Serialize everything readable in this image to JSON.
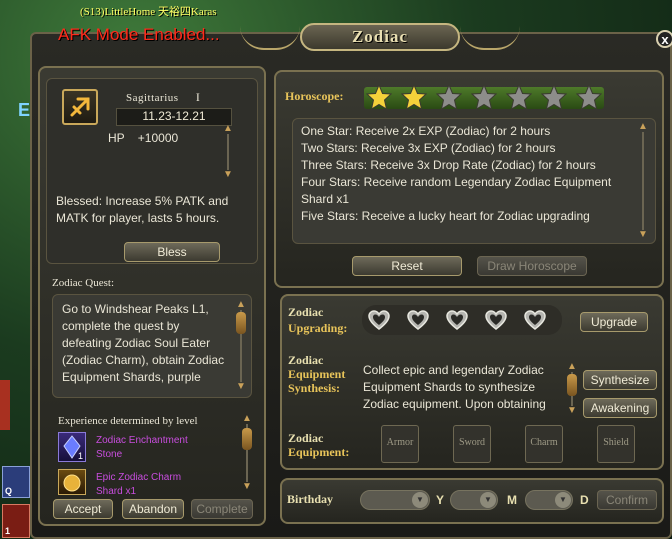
{
  "background": {
    "player_line": "(S13)LittleHome 天裕四Karas",
    "afk_text": "AFK Mode Enabled...",
    "side_letter": "E",
    "skill_q_key": "Q",
    "skill_1_key": "1"
  },
  "window": {
    "title": "Zodiac",
    "close_label": "x"
  },
  "sign": {
    "name": "Sagittarius",
    "numeral": "I",
    "dates": "11.23-12.21",
    "hp_label": "HP",
    "hp_value": "+10000",
    "blessing_text": "Blessed: Increase 5% PATK and MATK for player, lasts 5 hours.",
    "bless_button": "Bless"
  },
  "quest": {
    "header": "Zodiac Quest:",
    "text": "Go to Windshear Peaks L1, complete the quest by defeating Zodiac Soul Eater (Zodiac Charm), obtain Zodiac Equipment Shards, purple",
    "reward_header": "Experience determined by level",
    "rewards": [
      {
        "name": "Zodiac Enchantment Stone",
        "count": "1",
        "icon": "blue-gem-icon"
      },
      {
        "name": "Epic Zodiac Charm Shard x1",
        "count": "",
        "icon": "charm-shard-icon"
      }
    ],
    "accept_button": "Accept",
    "abandon_button": "Abandon",
    "complete_button": "Complete"
  },
  "horoscope": {
    "label": "Horoscope:",
    "stars_total": 7,
    "stars_lit": 2,
    "lines": [
      "One Star: Receive 2x EXP (Zodiac) for 2 hours",
      "Two Stars: Receive 3x EXP (Zodiac) for 2 hours",
      "Three Stars: Receive 3x Drop Rate (Zodiac) for 2 hours",
      "Four Stars: Receive random Legendary Zodiac Equipment Shard x1",
      "Five Stars: Receive a lucky heart for Zodiac upgrading"
    ],
    "reset_button": "Reset",
    "draw_button": "Draw Horoscope"
  },
  "upgrading": {
    "label_line1": "Zodiac",
    "label_line2": "Upgrading:",
    "heart_count": 5,
    "upgrade_button": "Upgrade"
  },
  "synthesis": {
    "label_line1": "Zodiac",
    "label_line2": "Equipment",
    "label_line3": "Synthesis:",
    "text": "Collect epic and legendary Zodiac Equipment Shards to synthesize Zodiac equipment. Upon obtaining",
    "synthesize_button": "Synthesize",
    "awakening_button": "Awakening"
  },
  "equipment": {
    "label_line1": "Zodiac",
    "label_line2": "Equipment:",
    "slots": [
      "Armor",
      "Sword",
      "Charm",
      "Shield"
    ]
  },
  "birthday": {
    "label": "Birthday",
    "y_label": "Y",
    "m_label": "M",
    "d_label": "D",
    "confirm_button": "Confirm"
  },
  "colors": {
    "gold": "#e8c45a",
    "star_lit": "#f4d23a",
    "star_unlit": "#8d8d8a",
    "afk_red": "#ff2a1a",
    "reward_purple": "#c84dde"
  }
}
